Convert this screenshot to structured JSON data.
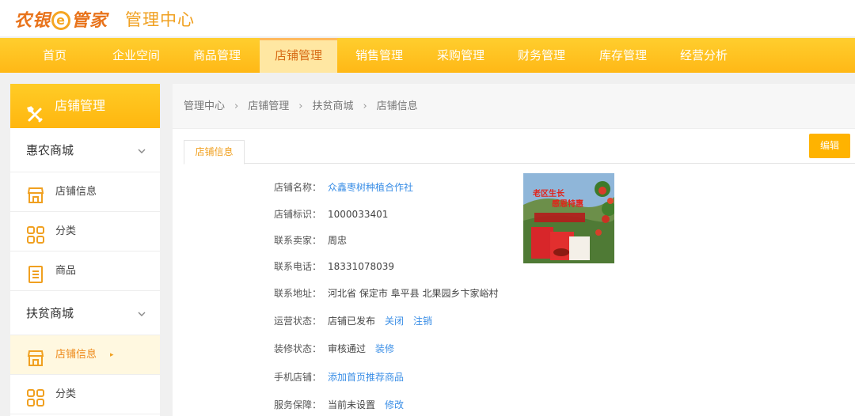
{
  "header": {
    "logo_a": "农银",
    "logo_e": "e",
    "logo_b": "管家",
    "admin_title": "管理中心"
  },
  "nav": [
    {
      "label": "首页"
    },
    {
      "label": "企业空间"
    },
    {
      "label": "商品管理"
    },
    {
      "label": "店铺管理"
    },
    {
      "label": "销售管理"
    },
    {
      "label": "采购管理"
    },
    {
      "label": "财务管理"
    },
    {
      "label": "库存管理"
    },
    {
      "label": "经营分析"
    }
  ],
  "sidebar": {
    "title": "店铺管理",
    "groups": [
      {
        "label": "惠农商城",
        "items": [
          {
            "label": "店铺信息"
          },
          {
            "label": "分类"
          },
          {
            "label": "商品"
          }
        ]
      },
      {
        "label": "扶贫商城",
        "items": [
          {
            "label": "店铺信息"
          },
          {
            "label": "分类"
          }
        ]
      }
    ],
    "active_arrow": "▸"
  },
  "breadcrumb": [
    "管理中心",
    "店铺管理",
    "扶贫商城",
    "店铺信息"
  ],
  "breadcrumb_sep": "›",
  "tab": "店铺信息",
  "edit_label": "编辑",
  "info": {
    "name_label": "店铺名称：",
    "name_value": "众鑫枣树种植合作社",
    "id_label": "店铺标识：",
    "id_value": "1000033401",
    "seller_label": "联系卖家：",
    "seller_value": "周忠",
    "phone_label": "联系电话：",
    "phone_value": "18331078039",
    "address_label": "联系地址：",
    "address_value": "河北省 保定市 阜平县 北果园乡卞家峪村",
    "status_label": "运营状态：",
    "status_value": "店铺已发布",
    "status_link1": "关闭",
    "status_link2": "注销",
    "decor_label": "装修状态：",
    "decor_value": "审核通过",
    "decor_link": "装修",
    "mobile_label": "手机店铺：",
    "mobile_link": "添加首页推荐商品",
    "service_label": "服务保障：",
    "service_value": "当前未设置",
    "service_link": "修改"
  },
  "shop_image": {
    "line1": "老区生长",
    "line2": "感恩特惠"
  },
  "colors": {
    "accent": "#ffb816",
    "active_nav_bg": "#ffe7a2",
    "link": "#3a8ee6"
  }
}
